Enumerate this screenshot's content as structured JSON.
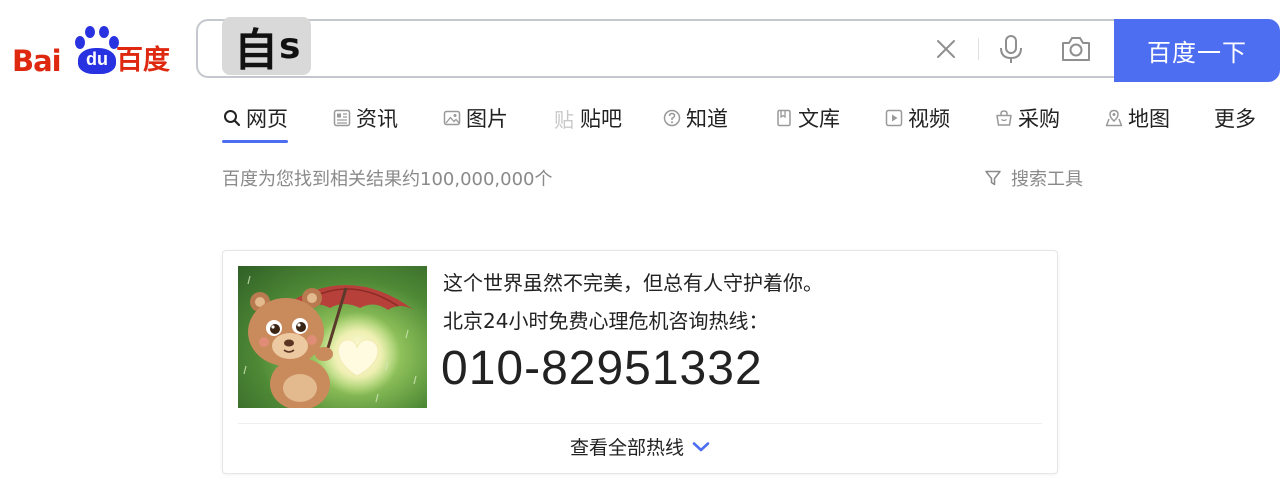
{
  "logo": {
    "latin_text": "Bai",
    "paw_text": "du",
    "chinese_text": "百度",
    "colors": {
      "red": "#de2910",
      "blue": "#2932e1"
    }
  },
  "search": {
    "query_chinese": "自",
    "query_latin": "s",
    "clear_icon": "close-icon",
    "voice_icon": "microphone-icon",
    "image_icon": "camera-icon",
    "button_label": "百度一下",
    "button_color": "#4e6ef2"
  },
  "tabs": [
    {
      "label": "网页",
      "icon": "search-icon",
      "active": true
    },
    {
      "label": "资讯",
      "icon": "news-icon",
      "active": false
    },
    {
      "label": "图片",
      "icon": "image-icon",
      "active": false
    },
    {
      "label": "贴吧",
      "icon": "tieba-icon",
      "active": false
    },
    {
      "label": "知道",
      "icon": "question-icon",
      "active": false
    },
    {
      "label": "文库",
      "icon": "document-icon",
      "active": false
    },
    {
      "label": "视频",
      "icon": "video-icon",
      "active": false
    },
    {
      "label": "采购",
      "icon": "shopping-basket-icon",
      "active": false
    },
    {
      "label": "地图",
      "icon": "map-icon",
      "active": false
    },
    {
      "label": "更多",
      "icon": "",
      "active": false
    }
  ],
  "result_count": "百度为您找到相关结果约100,000,000个",
  "search_tools": {
    "label": "搜索工具",
    "icon": "filter-icon"
  },
  "hotline_card": {
    "line1": "这个世界虽然不完美，但总有人守护着你。",
    "line2": "北京24小时免费心理危机咨询热线：",
    "phone": "010-82951332",
    "more_label": "查看全部热线",
    "more_icon": "chevron-down-icon",
    "image": "bear-with-umbrella-illustration"
  }
}
